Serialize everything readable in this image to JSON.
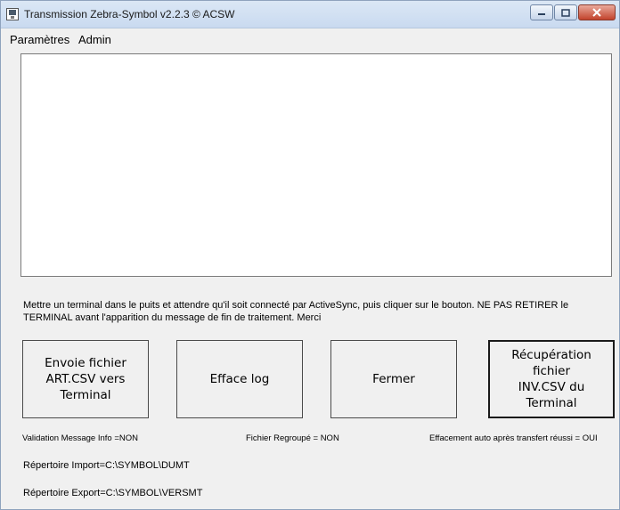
{
  "window": {
    "title": "Transmission Zebra-Symbol v2.2.3 © ACSW",
    "icon": "app-icon"
  },
  "menu": {
    "items": [
      {
        "label": "Paramètres"
      },
      {
        "label": "Admin"
      }
    ]
  },
  "log": {
    "content": ""
  },
  "instruction": {
    "text": "Mettre un terminal dans le puits et attendre qu'il soit connecté par ActiveSync, puis cliquer sur le bouton. NE PAS RETIRER le TERMINAL avant l'apparition du message de fin de traitement. Merci"
  },
  "buttons": {
    "send": "Envoie fichier\nART.CSV vers\nTerminal",
    "clear": "Efface log",
    "close": "Fermer",
    "retrieve": "Récupération fichier\nINV.CSV du\nTerminal"
  },
  "status": {
    "validation": "Validation Message Info =NON",
    "grouped": "Fichier Regroupé = NON",
    "auto_delete": "Effacement auto après transfert réussi = OUI"
  },
  "paths": {
    "import": "Répertoire Import=C:\\SYMBOL\\DUMT",
    "export": "Répertoire Export=C:\\SYMBOL\\VERSMT"
  },
  "colors": {
    "titlebar": "#c9daf0",
    "window_bg": "#f0f0f0",
    "close_button": "#c2432c"
  }
}
